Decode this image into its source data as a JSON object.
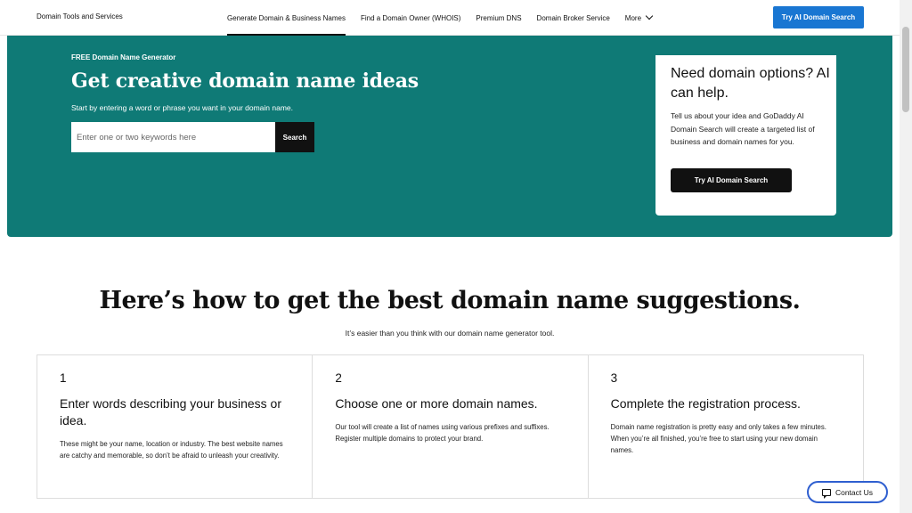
{
  "header": {
    "brand": "Domain Tools and Services",
    "nav": [
      {
        "label": "Generate Domain & Business Names"
      },
      {
        "label": "Find a Domain Owner (WHOIS)"
      },
      {
        "label": "Premium DNS"
      },
      {
        "label": "Domain Broker Service"
      },
      {
        "label": "More"
      }
    ],
    "cta": "Try AI Domain Search"
  },
  "hero": {
    "eyebrow": "FREE Domain Name Generator",
    "title": "Get creative domain name ideas",
    "subtitle": "Start by entering a word or phrase you want in your domain name.",
    "search_placeholder": "Enter one or two keywords here",
    "search_button": "Search",
    "bg_color": "#0f7a76"
  },
  "ai_card": {
    "title": "Need domain options? AI can help.",
    "body": "Tell us about your idea and GoDaddy AI Domain Search will create a targeted list of business and domain names for you.",
    "button": "Try AI Domain Search"
  },
  "steps_section": {
    "title": "Here’s how to get the best domain name suggestions.",
    "subtitle": "It’s easier than you think with our domain name generator tool.",
    "steps": [
      {
        "num": "1",
        "title": "Enter words describing your business or idea.",
        "desc": "These might be your name, location or industry. The best website names are catchy and memorable, so don’t be afraid to unleash your creativity."
      },
      {
        "num": "2",
        "title": "Choose one or more domain names.",
        "desc": "Our tool will create a list of names using various prefixes and suffixes. Register multiple domains to protect your brand."
      },
      {
        "num": "3",
        "title": "Complete the registration process.",
        "desc": "Domain name registration is pretty easy and only takes a few minutes. When you’re all finished, you’re free to start using your new domain names."
      }
    ]
  },
  "contact": {
    "label": "Contact Us"
  }
}
